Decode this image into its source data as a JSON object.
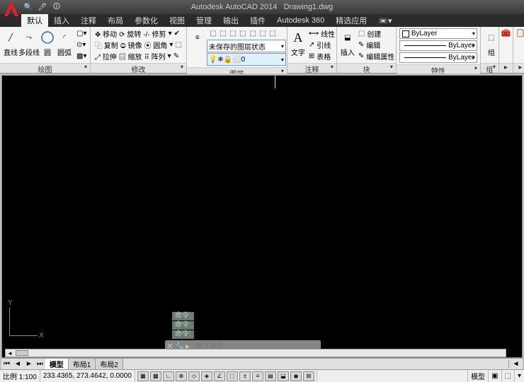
{
  "title": {
    "app": "Autodesk AutoCAD 2014",
    "file": "Drawing1.dwg"
  },
  "qat": [
    "🔍",
    "🖊",
    "🛈"
  ],
  "tabs": [
    "默认",
    "插入",
    "注释",
    "布局",
    "参数化",
    "视图",
    "管理",
    "输出",
    "插件",
    "Autodesk 360",
    "精选应用"
  ],
  "active_tab": 0,
  "panels": {
    "draw": {
      "title": "绘图",
      "items": [
        "直线",
        "多段线",
        "圆",
        "圆弧"
      ]
    },
    "modify": {
      "title": "修改",
      "rows": [
        [
          "✥ 移动",
          "⟳ 旋转",
          "-/- 修剪",
          "▾",
          "✔"
        ],
        [
          "⿻ 复制",
          "⦹ 镜像",
          "⦿ 圆角",
          "▾",
          "⬚"
        ],
        [
          "⤢ 拉伸",
          "▤ 缩放",
          "⠿ 阵列",
          "▾",
          "✎"
        ]
      ]
    },
    "layer": {
      "title": "图层",
      "unsaved": "未保存的图层状态",
      "current": "0",
      "icons": [
        "💡",
        "❄",
        "🔒",
        "⬜"
      ]
    },
    "annot": {
      "title": "注释",
      "text": "文字",
      "rows": [
        "线性",
        "引线",
        "表格"
      ]
    },
    "insert": {
      "title": "块",
      "main": "插入",
      "rows": [
        "创建",
        "编辑",
        "编辑属性"
      ]
    },
    "props": {
      "title": "特性",
      "bylayer": "ByLayer"
    },
    "group": {
      "title": "组",
      "label": "组"
    }
  },
  "layer_tool_icons": [
    "⬚",
    "⬚",
    "⬚",
    "⬚",
    "⬚",
    "⬚",
    "⬚",
    "⬚",
    "⬚"
  ],
  "cmd": {
    "history": [
      "命令:",
      "命令:",
      "命令:"
    ],
    "placeholder": "键入命令"
  },
  "model_tabs": [
    "模型",
    "布局1",
    "布局2"
  ],
  "status": {
    "scale": "比例 1:100",
    "coords": "233.4365, 273.4642, 0.0000",
    "model": "模型"
  },
  "ucs": {
    "x": "X",
    "y": "Y"
  }
}
